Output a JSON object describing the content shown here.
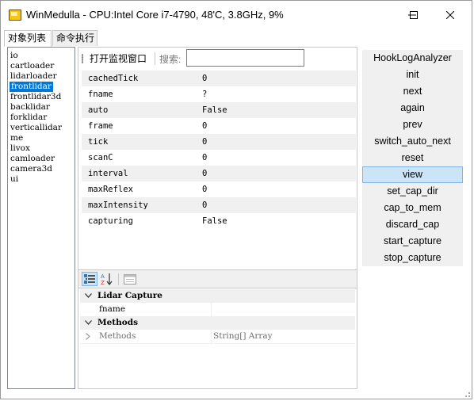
{
  "window": {
    "title": "WinMedulla - CPU:Intel Core i7-4790, 48'C, 3.8GHz, 9%",
    "controls": [
      "minimize-icon",
      "maximize-icon",
      "close-icon"
    ]
  },
  "tabs": [
    {
      "label": "对象列表",
      "active": true
    },
    {
      "label": "命令执行",
      "active": false
    }
  ],
  "objects": [
    "io",
    "cartloader",
    "lidarloader",
    "frontlidar",
    "frontlidar3d",
    "backlidar",
    "forklidar",
    "verticallidar",
    "me",
    "livox",
    "camloader",
    "camera3d",
    "ui"
  ],
  "selected_object": "frontlidar",
  "toolbar": {
    "open_monitor_label": "打开监视窗口",
    "search_label": "搜索:",
    "search_value": ""
  },
  "properties": [
    {
      "key": "cachedTick",
      "value": "0"
    },
    {
      "key": "fname",
      "value": "?"
    },
    {
      "key": "auto",
      "value": "False"
    },
    {
      "key": "frame",
      "value": "0"
    },
    {
      "key": "tick",
      "value": "0"
    },
    {
      "key": "scanC",
      "value": "0"
    },
    {
      "key": "interval",
      "value": "0"
    },
    {
      "key": "maxReflex",
      "value": "0"
    },
    {
      "key": "maxIntensity",
      "value": "0"
    },
    {
      "key": "capturing",
      "value": "False"
    }
  ],
  "property_grid": {
    "toolbar_icons": [
      "categorized-icon",
      "alphabetical-icon",
      "property-pages-icon"
    ],
    "categories": [
      {
        "name": "Lidar Capture",
        "rows": [
          {
            "name": "fname",
            "value": ""
          }
        ]
      },
      {
        "name": "Methods",
        "rows": [
          {
            "name": "Methods",
            "value": "String[] Array"
          }
        ]
      }
    ]
  },
  "commands": [
    "HookLogAnalyzer",
    "init",
    "next",
    "again",
    "prev",
    "switch_auto_next",
    "reset",
    "view",
    "set_cap_dir",
    "cap_to_mem",
    "discard_cap",
    "start_capture",
    "stop_capture"
  ],
  "selected_command": "view"
}
